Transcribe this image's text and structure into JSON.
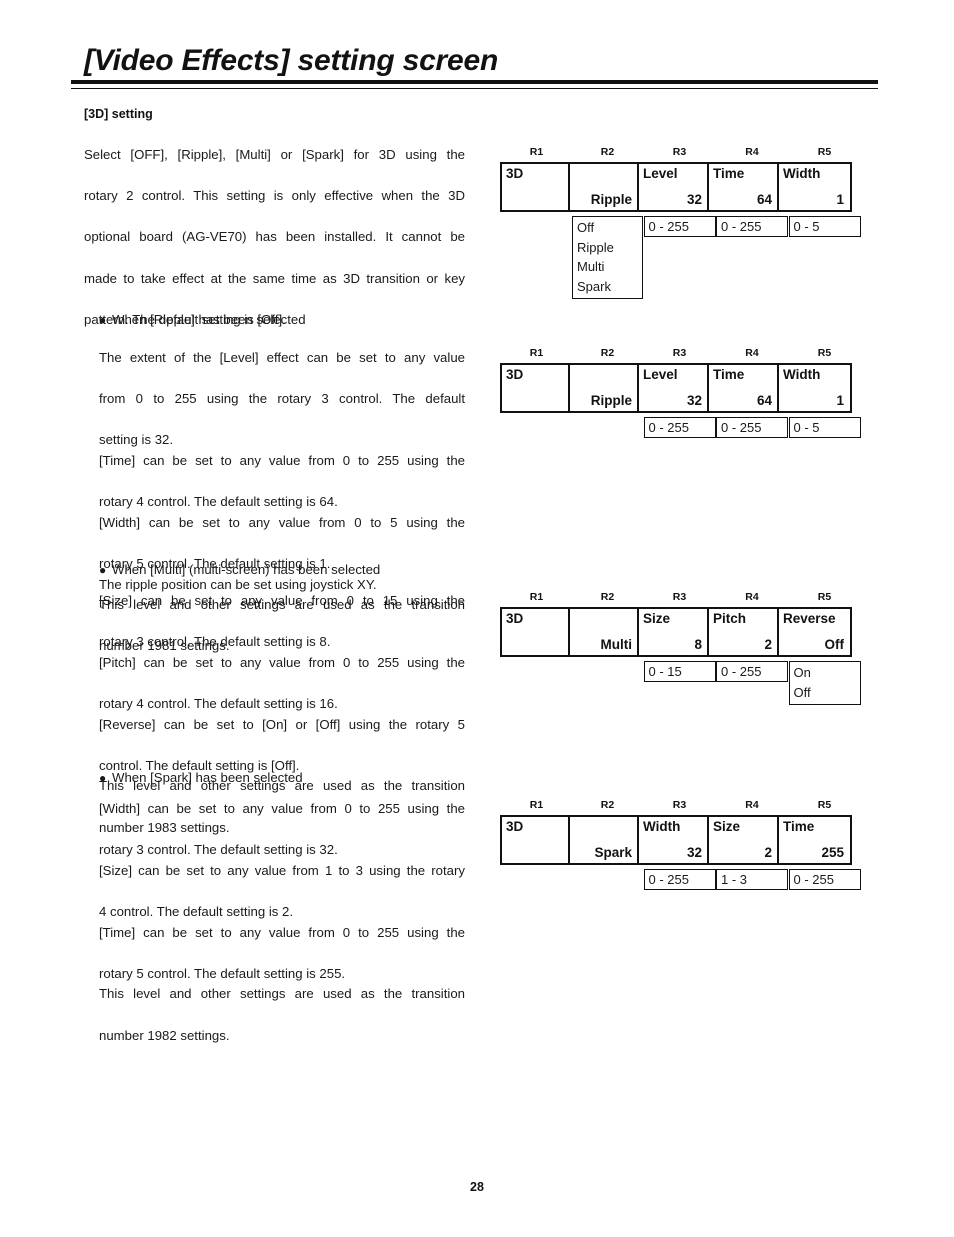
{
  "document": {
    "title": "[Video Effects] setting screen",
    "section_heading": "[3D] setting",
    "page_number": "28"
  },
  "intro": {
    "lines": [
      "Select [OFF], [Ripple], [Multi] or [Spark] for 3D using the",
      "rotary 2 control.  This setting is only effective when the 3D",
      "optional board (AG-VE70) has been installed.  It cannot be",
      "made to take effect at the same time as 3D transition or key",
      "pattern.  The default setting is [Off]."
    ]
  },
  "sections": [
    {
      "bullet": "When [Ripple] has been selected",
      "lines": [
        "The extent of the [Level] effect can be set to any value",
        "from 0 to 255 using the rotary 3 control.  The default",
        "setting is 32.",
        "[Time] can be set to any value from 0 to 255 using the",
        "rotary 4 control.  The default setting is 64.",
        "[Width] can be set to any value from 0 to 5 using the",
        "rotary 5 control.  The default setting is 1.",
        "The ripple position can be set using joystick XY.",
        "This level and other settings are used as the transition",
        "number 1981 settings."
      ]
    },
    {
      "bullet": "When [Multi] (multi-screen) has been selected",
      "lines": [
        "[Size] can be set to any value from 0 to 15 using the",
        "rotary 3 control.  The default setting is 8.",
        "[Pitch] can be set to any value from 0 to 255 using the",
        "rotary 4 control.  The default setting is 16.",
        "[Reverse] can be set to [On] or [Off] using the rotary 5",
        "control.  The default setting is [Off].",
        "This level and other settings are used as the transition",
        "number 1983 settings."
      ]
    },
    {
      "bullet": "When [Spark] has been selected",
      "lines": [
        "[Width] can be set to any value from 0 to 255 using the",
        "rotary 3 control.  The default setting is 32.",
        "[Size] can be set to any value from 1 to 3 using the rotary",
        "4 control.  The default setting is 2.",
        "[Time] can be set to any value from 0 to 255 using the",
        "rotary 5 control.  The default setting is 255.",
        "This level and other settings are used as the transition",
        "number 1982 settings."
      ]
    }
  ],
  "rotary_headers": [
    "R1",
    "R2",
    "R3",
    "R4",
    "R5"
  ],
  "diagrams": [
    {
      "name": "3d-off-selection",
      "cells": [
        {
          "label": "3D",
          "value": ""
        },
        {
          "label": "",
          "value": "Ripple"
        },
        {
          "label": "Level",
          "value": "32"
        },
        {
          "label": "Time",
          "value": "64"
        },
        {
          "label": "Width",
          "value": "1"
        }
      ],
      "under": [
        {
          "col": 2,
          "type": "options",
          "items": [
            "Off",
            "Ripple",
            "Multi",
            "Spark"
          ]
        },
        {
          "col": 3,
          "type": "range",
          "text": "0 - 255"
        },
        {
          "col": 4,
          "type": "range",
          "text": "0 - 255"
        },
        {
          "col": 5,
          "type": "range",
          "text": "0 - 5"
        }
      ]
    },
    {
      "name": "3d-ripple-settings",
      "cells": [
        {
          "label": "3D",
          "value": ""
        },
        {
          "label": "",
          "value": "Ripple"
        },
        {
          "label": "Level",
          "value": "32"
        },
        {
          "label": "Time",
          "value": "64"
        },
        {
          "label": "Width",
          "value": "1"
        }
      ],
      "under": [
        {
          "col": 3,
          "type": "range",
          "text": "0 - 255"
        },
        {
          "col": 4,
          "type": "range",
          "text": "0 - 255"
        },
        {
          "col": 5,
          "type": "range",
          "text": "0 - 5"
        }
      ]
    },
    {
      "name": "3d-multi-settings",
      "cells": [
        {
          "label": "3D",
          "value": ""
        },
        {
          "label": "",
          "value": "Multi"
        },
        {
          "label": "Size",
          "value": "8"
        },
        {
          "label": "Pitch",
          "value": "2"
        },
        {
          "label": "Reverse",
          "value": "Off"
        }
      ],
      "under": [
        {
          "col": 3,
          "type": "range",
          "text": "0 - 15"
        },
        {
          "col": 4,
          "type": "range",
          "text": "0 - 255"
        },
        {
          "col": 5,
          "type": "options",
          "items": [
            "On",
            "Off"
          ]
        }
      ]
    },
    {
      "name": "3d-spark-settings",
      "cells": [
        {
          "label": "3D",
          "value": ""
        },
        {
          "label": "",
          "value": "Spark"
        },
        {
          "label": "Width",
          "value": "32"
        },
        {
          "label": "Size",
          "value": "2"
        },
        {
          "label": "Time",
          "value": "255"
        }
      ],
      "under": [
        {
          "col": 3,
          "type": "range",
          "text": "0 - 255"
        },
        {
          "col": 4,
          "type": "range",
          "text": "1 - 3"
        },
        {
          "col": 5,
          "type": "range",
          "text": "0 - 255"
        }
      ]
    }
  ]
}
